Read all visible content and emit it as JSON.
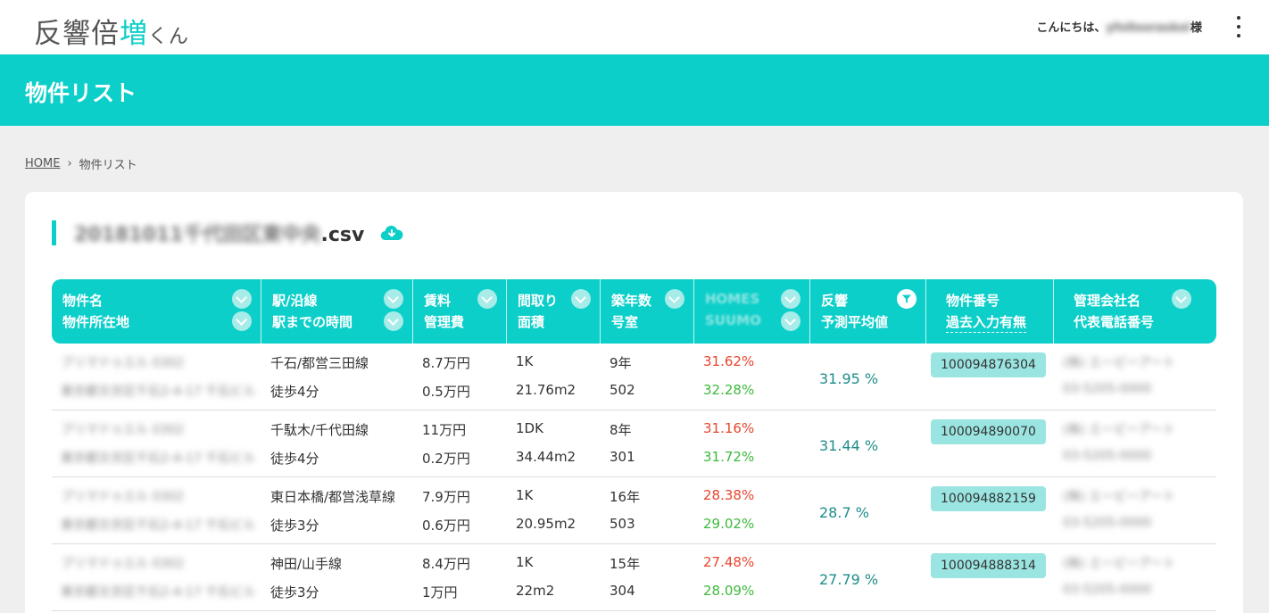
{
  "app": {
    "logo_main": "反響倍",
    "logo_accent": "増",
    "logo_small": "くん",
    "greeting_prefix": "こんにちは、",
    "username": "yfo0ooraskol",
    "greeting_suffix": "様"
  },
  "page": {
    "title": "物件リスト"
  },
  "breadcrumb": {
    "home": "HOME",
    "separator": "›",
    "current": "物件リスト"
  },
  "file": {
    "name_blurred": "20181011千代田区東中央",
    "extension": ".csv"
  },
  "table": {
    "headers": [
      {
        "line1": "物件名",
        "line2": "物件所在地"
      },
      {
        "line1": "駅/沿線",
        "line2": "駅までの時間"
      },
      {
        "line1": "賃料",
        "line2": "管理費"
      },
      {
        "line1": "間取り",
        "line2": "面積"
      },
      {
        "line1": "築年数",
        "line2": "号室"
      },
      {
        "line1": "HOMES",
        "line2": "SUUMO"
      },
      {
        "line1": "反響",
        "line2": "予測平均値"
      },
      {
        "line1": "物件番号",
        "line2": "過去入力有無"
      },
      {
        "line1": "管理会社名",
        "line2": "代表電話番号"
      }
    ],
    "rows": [
      {
        "name": "プリマドゥエル 0302",
        "address": "東京都文京区千石2-4-17 千石ビル",
        "line": "千石/都営三田線",
        "walk": "徒歩4分",
        "rent": "8.7万円",
        "fee": "0.5万円",
        "layout": "1K",
        "area": "21.76m2",
        "age": "9年",
        "room": "502",
        "homes": "31.62%",
        "suumo": "32.28%",
        "prediction": "31.95 %",
        "id": "100094876304",
        "company": "(株) エーピーアート",
        "phone": "03-5205-0000"
      },
      {
        "name": "プリマドゥエル 0302",
        "address": "東京都文京区千石2-4-17 千石ビル",
        "line": "千駄木/千代田線",
        "walk": "徒歩4分",
        "rent": "11万円",
        "fee": "0.2万円",
        "layout": "1DK",
        "area": "34.44m2",
        "age": "8年",
        "room": "301",
        "homes": "31.16%",
        "suumo": "31.72%",
        "prediction": "31.44 %",
        "id": "100094890070",
        "company": "(株) エーピーアート",
        "phone": "03-5205-0000"
      },
      {
        "name": "プリマドゥエル 0302",
        "address": "東京都文京区千石2-4-17 千石ビル",
        "line": "東日本橋/都営浅草線",
        "walk": "徒歩3分",
        "rent": "7.9万円",
        "fee": "0.6万円",
        "layout": "1K",
        "area": "20.95m2",
        "age": "16年",
        "room": "503",
        "homes": "28.38%",
        "suumo": "29.02%",
        "prediction": "28.7 %",
        "id": "100094882159",
        "company": "(株) エーピーアート",
        "phone": "03-5205-0000"
      },
      {
        "name": "プリマドゥエル 0302",
        "address": "東京都文京区千石2-4-17 千石ビル",
        "line": "神田/山手線",
        "walk": "徒歩3分",
        "rent": "8.4万円",
        "fee": "1万円",
        "layout": "1K",
        "area": "22m2",
        "age": "15年",
        "room": "304",
        "homes": "27.48%",
        "suumo": "28.09%",
        "prediction": "27.79 %",
        "id": "100094888314",
        "company": "(株) エーピーアート",
        "phone": "03-5205-0000"
      }
    ]
  },
  "colors": {
    "accent": "#0dcfca",
    "badge": "#9ae5e1",
    "homes_red": "#e8452c",
    "suumo_green": "#3dba3d",
    "prediction_teal": "#1f8d8a"
  }
}
